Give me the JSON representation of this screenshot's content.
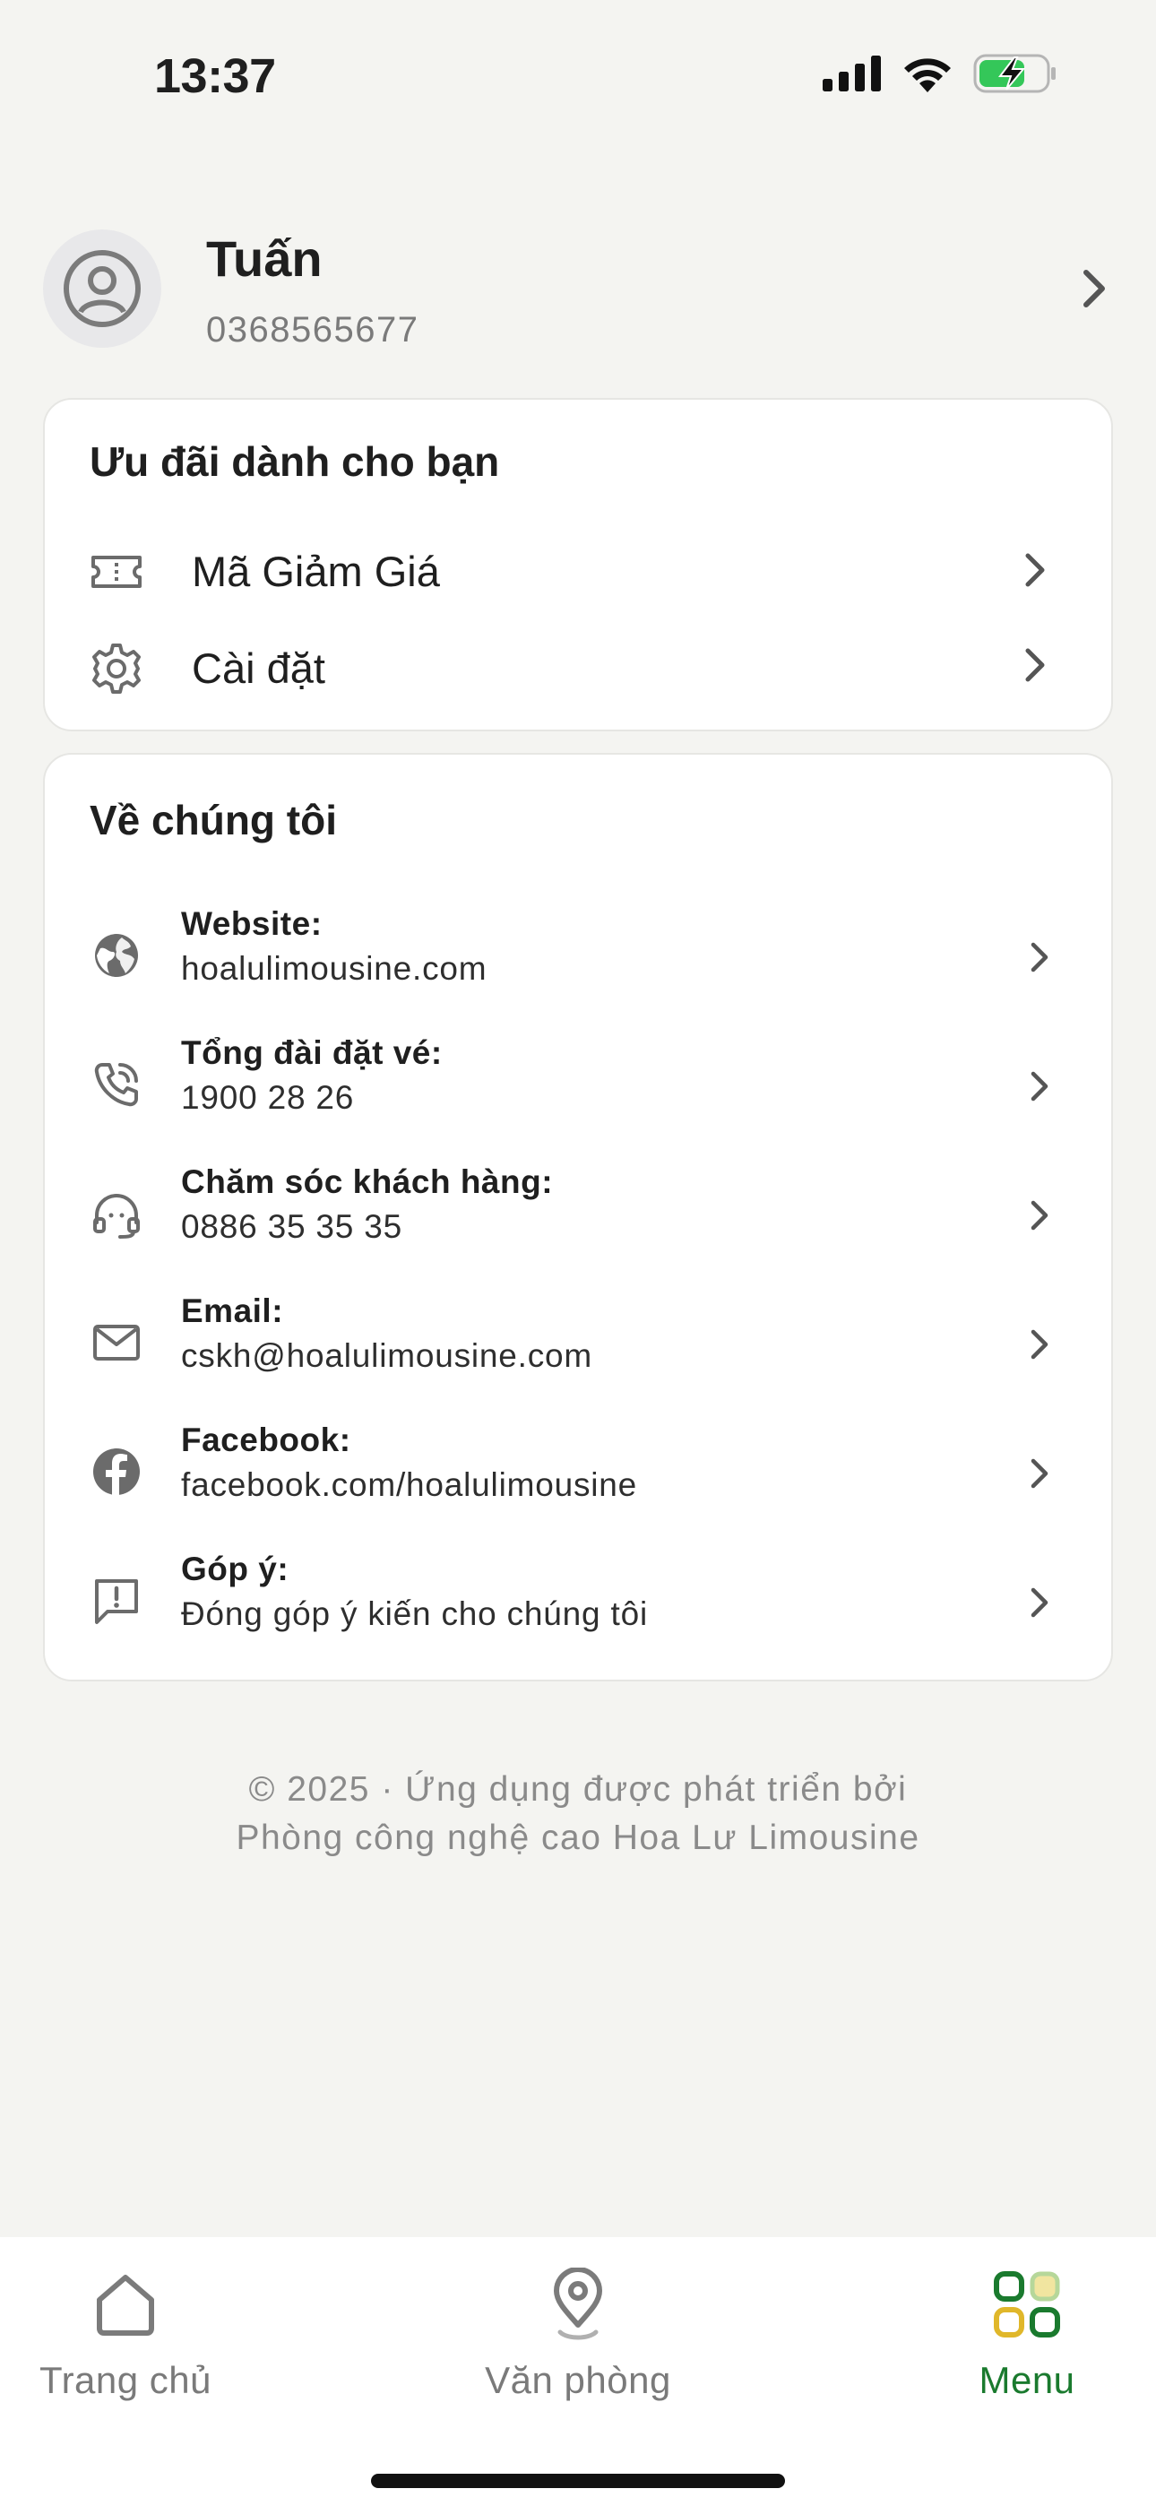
{
  "status_bar": {
    "time": "13:37"
  },
  "profile": {
    "name": "Tuấn",
    "phone": "0368565677"
  },
  "offers": {
    "title": "Ưu đãi dành cho bạn",
    "items": [
      {
        "label": "Mã Giảm Giá",
        "icon": "ticket-icon"
      },
      {
        "label": "Cài đặt",
        "icon": "gear-icon"
      }
    ]
  },
  "about": {
    "title": "Về chúng tôi",
    "items": [
      {
        "label": "Website:",
        "value": "hoalulimousine.com",
        "icon": "globe-icon"
      },
      {
        "label": "Tổng đài đặt vé:",
        "value": "1900 28 26",
        "icon": "phone-icon"
      },
      {
        "label": "Chăm sóc khách hàng:",
        "value": "0886 35 35 35",
        "icon": "headset-icon"
      },
      {
        "label": "Email:",
        "value": "cskh@hoalulimousine.com",
        "icon": "mail-icon"
      },
      {
        "label": "Facebook:",
        "value": "facebook.com/hoalulimousine",
        "icon": "facebook-icon"
      },
      {
        "label": "Góp ý:",
        "value": "Đóng góp ý kiến cho chúng tôi",
        "icon": "feedback-icon"
      }
    ]
  },
  "footer": {
    "line1": "© 2025 · Ứng dụng được phát triển bởi",
    "line2": "Phòng công nghệ cao Hoa Lư Limousine"
  },
  "tab_bar": {
    "tabs": [
      {
        "label": "Trang chủ",
        "icon": "home-icon",
        "active": false
      },
      {
        "label": "Văn phòng",
        "icon": "location-pin-icon",
        "active": false
      },
      {
        "label": "Menu",
        "icon": "menu-grid-icon",
        "active": true
      }
    ]
  },
  "colors": {
    "accent": "#1a7a2e",
    "background": "#f4f4f1",
    "card": "#ffffff"
  }
}
